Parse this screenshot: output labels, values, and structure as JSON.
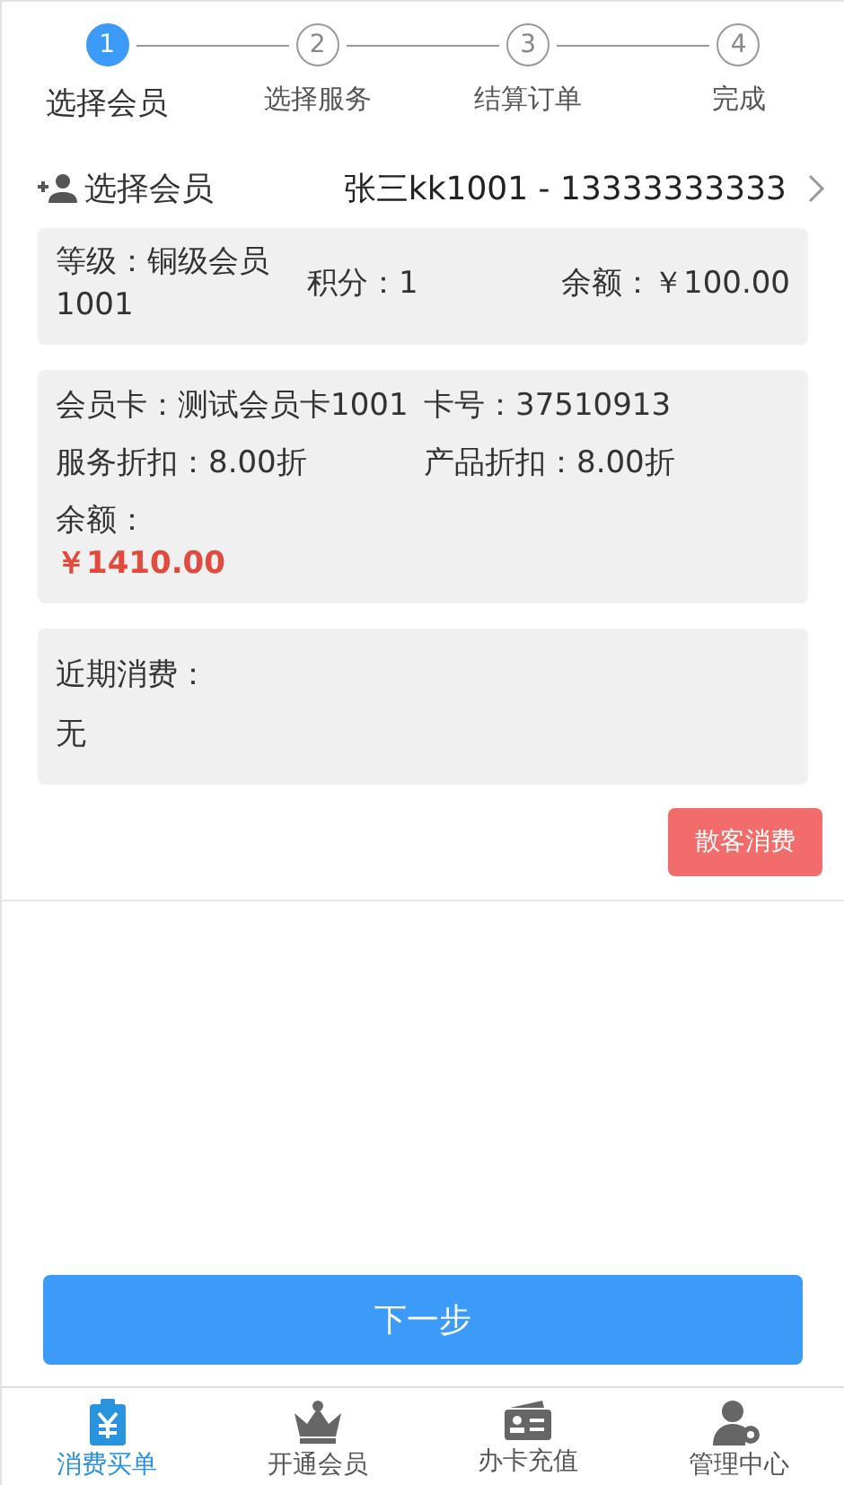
{
  "steps": [
    {
      "number": "1",
      "label": "选择会员",
      "selected": true
    },
    {
      "number": "2",
      "label": "选择服务",
      "selected": false
    },
    {
      "number": "3",
      "label": "结算订单",
      "selected": false
    },
    {
      "number": "4",
      "label": "完成",
      "selected": false
    }
  ],
  "member_row": {
    "label": "选择会员",
    "value": "张三kk1001 - 13333333333"
  },
  "member_info": {
    "level": "等级：铜级会员1001",
    "points": "积分：1",
    "balance": "余额：￥100.00"
  },
  "card_info": {
    "card": "会员卡：测试会员卡1001",
    "number": "卡号：37510913",
    "service_discount": "服务折扣：8.00折",
    "product_discount": "产品折扣：8.00折",
    "balance_label": "余额：",
    "balance_value": "￥1410.00"
  },
  "recent": {
    "label": "近期消费：",
    "value": "无"
  },
  "walk_in_button": "散客消费",
  "next_button": "下一步",
  "tabs": [
    {
      "kind": "order",
      "label": "消费买单",
      "selected": true
    },
    {
      "kind": "crown",
      "label": "开通会员",
      "selected": false
    },
    {
      "kind": "card",
      "label": "办卡充值",
      "selected": false
    },
    {
      "kind": "admin",
      "label": "管理中心",
      "selected": false
    }
  ]
}
